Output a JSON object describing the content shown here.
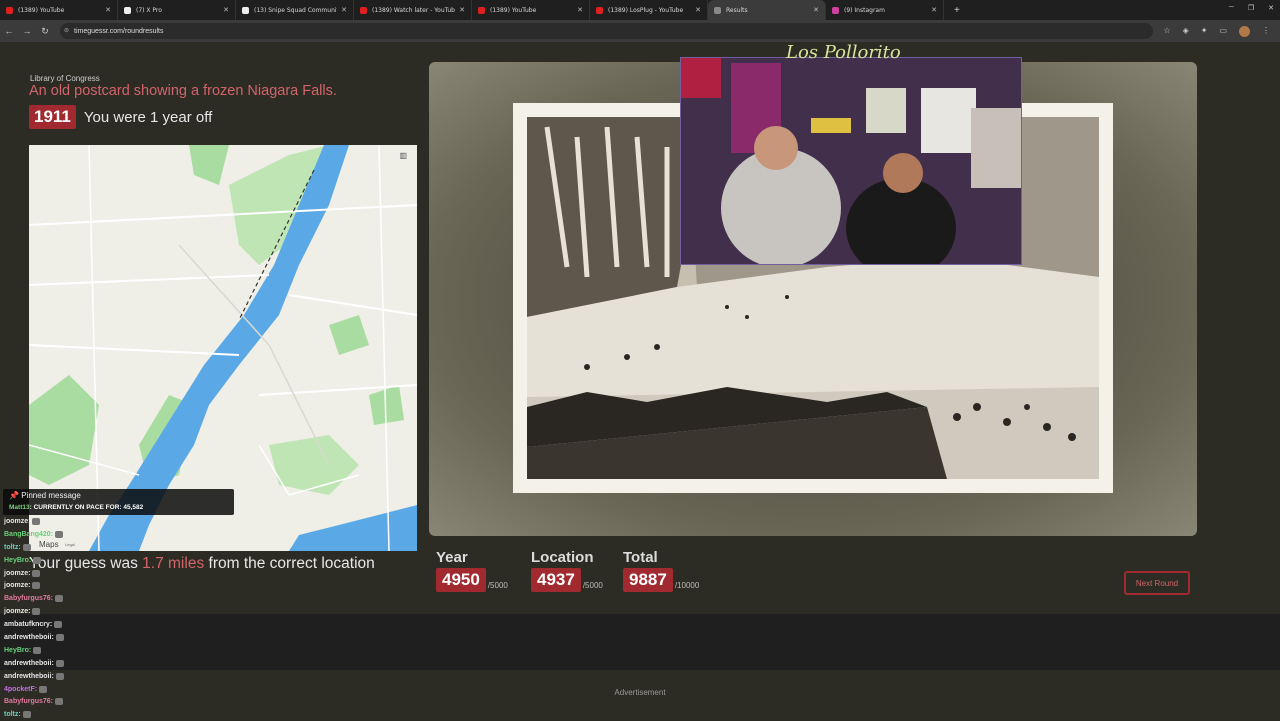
{
  "browser": {
    "tabs": [
      {
        "title": "(1389) YouTube",
        "fav": "#e02020"
      },
      {
        "title": "(7) X Pro",
        "fav": "#eeeeee"
      },
      {
        "title": "(13) Snipe Squad Community /",
        "fav": "#eeeeee"
      },
      {
        "title": "(1389) Watch later - YouTube",
        "fav": "#e02020"
      },
      {
        "title": "(1389) YouTube",
        "fav": "#e02020"
      },
      {
        "title": "(1389) LosPlug - YouTube",
        "fav": "#e02020"
      },
      {
        "title": "Results",
        "fav": "#888888"
      },
      {
        "title": "(9) Instagram",
        "fav": "#d040a0"
      }
    ],
    "url": "timeguessr.com/roundresults"
  },
  "round": {
    "source": "Library of Congress",
    "headline": "An old postcard showing a frozen Niagara Falls.",
    "year": "1911",
    "year_off": "You were 1 year off",
    "distance_prefix": "Your guess was",
    "distance_value": "1.7 miles",
    "distance_suffix": "from the correct location"
  },
  "map": {
    "label": "Maps",
    "legal": "Legal"
  },
  "scores": {
    "year_label": "Year",
    "year_value": "4950",
    "year_max": "/5000",
    "location_label": "Location",
    "location_value": "4937",
    "location_max": "/5000",
    "total_label": "Total",
    "total_value": "9887",
    "total_max": "/10000"
  },
  "next_button": "Next Round",
  "advertisement": "Advertisement",
  "overlay": {
    "signature": "Los Pollorito",
    "pinned_title": "Pinned message",
    "pinned_user": "Matt13",
    "pinned_text": ": CURRENTLY ON PACE FOR: 45,582"
  },
  "chat": [
    {
      "user": "joomze:",
      "color": "#e6e6e6"
    },
    {
      "user": "BangBang420:",
      "color": "#6ad07a"
    },
    {
      "user": "toltz:",
      "color": "#6ad0c0"
    },
    {
      "user": "HeyBro:",
      "color": "#6ad07a"
    },
    {
      "user": "joomze:",
      "color": "#e6e6e6"
    },
    {
      "user": "joomze:",
      "color": "#e6e6e6"
    },
    {
      "user": "Babyfurgus76:",
      "color": "#e07aa0"
    },
    {
      "user": "joomze:",
      "color": "#e6e6e6"
    },
    {
      "user": "ambatufkncry:",
      "color": "#e6e6e6"
    },
    {
      "user": "andrewtheboii:",
      "color": "#e6e6e6"
    },
    {
      "user": "HeyBro:",
      "color": "#6ad07a"
    },
    {
      "user": "andrewtheboii:",
      "color": "#e6e6e6"
    },
    {
      "user": "andrewtheboii:",
      "color": "#e6e6e6"
    },
    {
      "user": "4pocketF:",
      "color": "#c070e0"
    },
    {
      "user": "Babyfurgus76:",
      "color": "#e07aa0"
    },
    {
      "user": "toltz:",
      "color": "#6ad0c0"
    }
  ],
  "colors": {
    "accent": "#a02a30",
    "accent_text": "#d2646b",
    "water": "#5aa9e6",
    "park": "#a8dca0"
  }
}
